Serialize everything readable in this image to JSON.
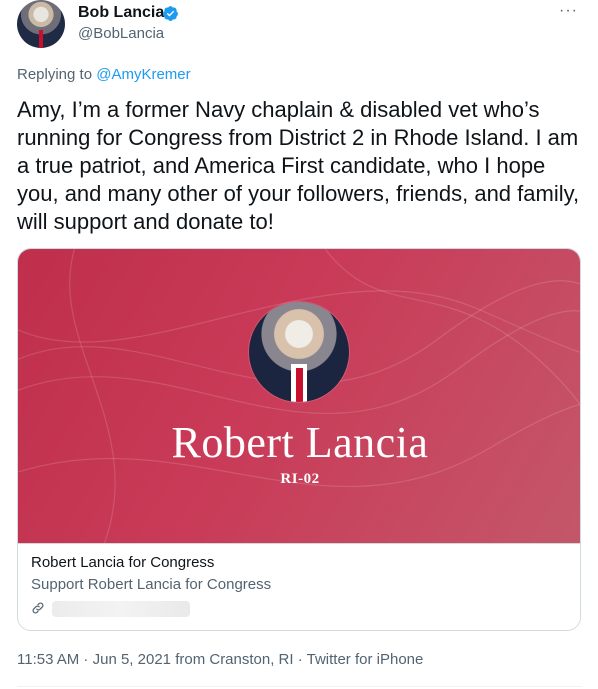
{
  "author": {
    "display_name": "Bob Lancia",
    "handle": "@BobLancia",
    "verified": true
  },
  "more_label": "···",
  "reply": {
    "prefix": "Replying to ",
    "to": "@AmyKremer"
  },
  "tweet": {
    "text": "Amy, I’m a former Navy chaplain & disabled vet who’s running for Congress from District 2 in Rhode Island. I am a true patriot, and America First candidate, who I hope you, and many other of your followers, friends, and family, will support and donate to!"
  },
  "card": {
    "image_headline": "Robert Lancia",
    "image_subtitle": "RI-02",
    "title": "Robert Lancia for Congress",
    "description": "Support Robert Lancia for Congress",
    "link_icon": "link-icon"
  },
  "meta": {
    "time": "11:53 AM",
    "date": "Jun 5, 2021",
    "location": "from Cranston, RI",
    "source": "Twitter for iPhone",
    "separator": " · "
  },
  "colors": {
    "accent": "#1d9bf0",
    "card_background": "#c23a55",
    "muted": "#536471"
  }
}
